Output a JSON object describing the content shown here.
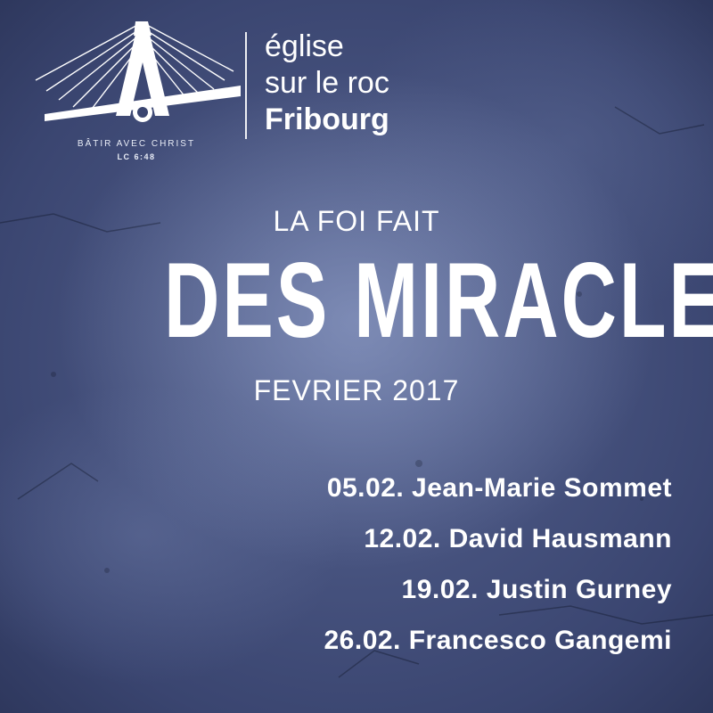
{
  "logo": {
    "icon": "bridge-a-icon",
    "church_name": [
      "église",
      "sur le roc",
      "Fribourg"
    ],
    "tagline": "BÂTIR AVEC CHRIST",
    "verse": "LC 6:48"
  },
  "headline": {
    "kicker": "LA FOI FAIT",
    "title": "DES MIRACLES",
    "month": "FEVRIER 2017"
  },
  "schedule": [
    "05.02. Jean-Marie Sommet",
    "12.02. David Hausmann",
    "19.02. Justin Gurney",
    "26.02. Francesco Gangemi"
  ],
  "colors": {
    "background": "#3a4570",
    "text": "#ffffff"
  }
}
